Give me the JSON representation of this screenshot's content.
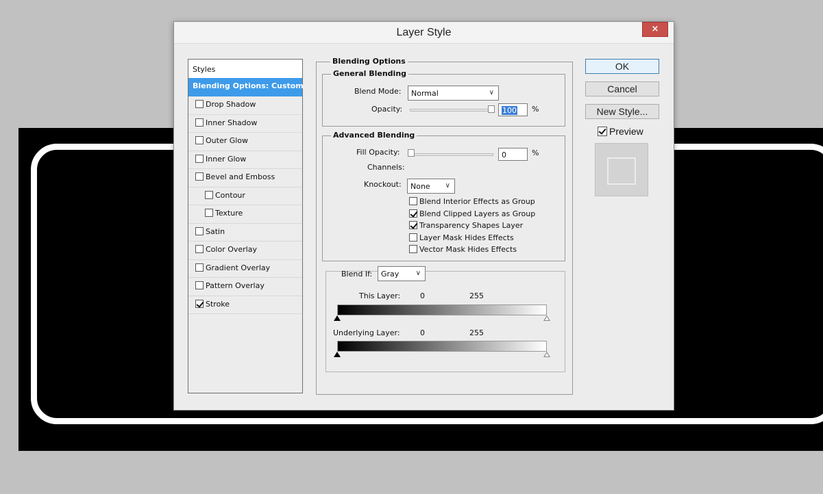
{
  "dialog": {
    "title": "Layer Style",
    "close_label": "×"
  },
  "styles_panel": {
    "header": "Styles",
    "items": [
      {
        "label": "Blending Options: Custom",
        "checkbox": false,
        "checked": false,
        "selected": true,
        "indent": false
      },
      {
        "label": "Drop Shadow",
        "checkbox": true,
        "checked": false,
        "selected": false,
        "indent": false
      },
      {
        "label": "Inner Shadow",
        "checkbox": true,
        "checked": false,
        "selected": false,
        "indent": false
      },
      {
        "label": "Outer Glow",
        "checkbox": true,
        "checked": false,
        "selected": false,
        "indent": false
      },
      {
        "label": "Inner Glow",
        "checkbox": true,
        "checked": false,
        "selected": false,
        "indent": false
      },
      {
        "label": "Bevel and Emboss",
        "checkbox": true,
        "checked": false,
        "selected": false,
        "indent": false
      },
      {
        "label": "Contour",
        "checkbox": true,
        "checked": false,
        "selected": false,
        "indent": true
      },
      {
        "label": "Texture",
        "checkbox": true,
        "checked": false,
        "selected": false,
        "indent": true
      },
      {
        "label": "Satin",
        "checkbox": true,
        "checked": false,
        "selected": false,
        "indent": false
      },
      {
        "label": "Color Overlay",
        "checkbox": true,
        "checked": false,
        "selected": false,
        "indent": false
      },
      {
        "label": "Gradient Overlay",
        "checkbox": true,
        "checked": false,
        "selected": false,
        "indent": false
      },
      {
        "label": "Pattern Overlay",
        "checkbox": true,
        "checked": false,
        "selected": false,
        "indent": false
      },
      {
        "label": "Stroke",
        "checkbox": true,
        "checked": true,
        "selected": false,
        "indent": false
      }
    ]
  },
  "blending_options": {
    "title": "Blending Options",
    "general": {
      "title": "General Blending",
      "blend_mode_label": "Blend Mode:",
      "blend_mode_value": "Normal",
      "opacity_label": "Opacity:",
      "opacity_value": "100",
      "opacity_unit": "%"
    },
    "advanced": {
      "title": "Advanced Blending",
      "fill_opacity_label": "Fill Opacity:",
      "fill_opacity_value": "0",
      "fill_opacity_unit": "%",
      "channels_label": "Channels:",
      "knockout_label": "Knockout:",
      "knockout_value": "None",
      "options": [
        {
          "label": "Blend Interior Effects as Group",
          "checked": false
        },
        {
          "label": "Blend Clipped Layers as Group",
          "checked": true
        },
        {
          "label": "Transparency Shapes Layer",
          "checked": true
        },
        {
          "label": "Layer Mask Hides Effects",
          "checked": false
        },
        {
          "label": "Vector Mask Hides Effects",
          "checked": false
        }
      ]
    },
    "blend_if": {
      "label": "Blend If:",
      "value": "Gray",
      "this_layer_label": "This Layer:",
      "this_layer_min": "0",
      "this_layer_max": "255",
      "underlying_label": "Underlying Layer:",
      "underlying_min": "0",
      "underlying_max": "255"
    }
  },
  "buttons": {
    "ok": "OK",
    "cancel": "Cancel",
    "new_style": "New Style...",
    "preview": "Preview"
  },
  "colors": {
    "selection": "#3d9be9",
    "close": "#c7504a"
  }
}
